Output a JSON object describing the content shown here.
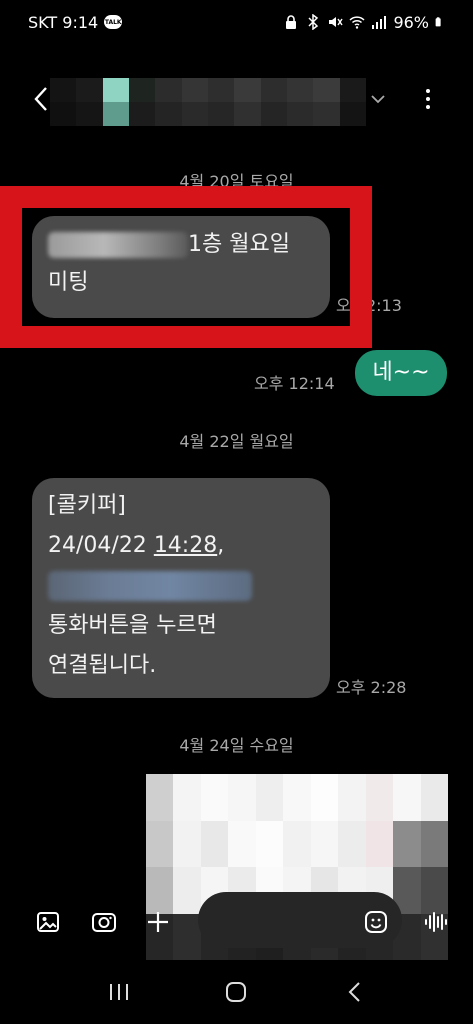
{
  "status": {
    "carrier_time": "SKT 9:14",
    "talk_badge": "TALK",
    "battery": "96%"
  },
  "header": {
    "title_blurred": true
  },
  "messages": {
    "date1": "4월 20일 토요일",
    "msg1_line1": "1층 월요일",
    "msg1_line2": "미팅",
    "msg1_time": "오 12:13",
    "msg2_text": "네~~",
    "msg2_time": "오후 12:14",
    "date2": "4월 22일 월요일",
    "msg3_line1": "[콜키퍼]",
    "msg3_line2_date": "24/04/22 ",
    "msg3_line2_time": "14:28",
    "msg3_line2_comma": ",",
    "msg3_line4": "통화버튼을 누르면",
    "msg3_line5": "연결됩니다.",
    "msg3_time": "오후 2:28",
    "date3": "4월 24일 수요일"
  },
  "composer": {
    "input_value": "",
    "input_placeholder": ""
  },
  "colors": {
    "bubble_in": "#4a4a4a",
    "bubble_out": "#1d8f6f",
    "highlight": "#d8141b"
  },
  "icons": [
    "gallery-icon",
    "camera-icon",
    "plus-icon",
    "emoji-icon",
    "voice-icon",
    "recents-icon",
    "home-icon",
    "back-icon"
  ]
}
